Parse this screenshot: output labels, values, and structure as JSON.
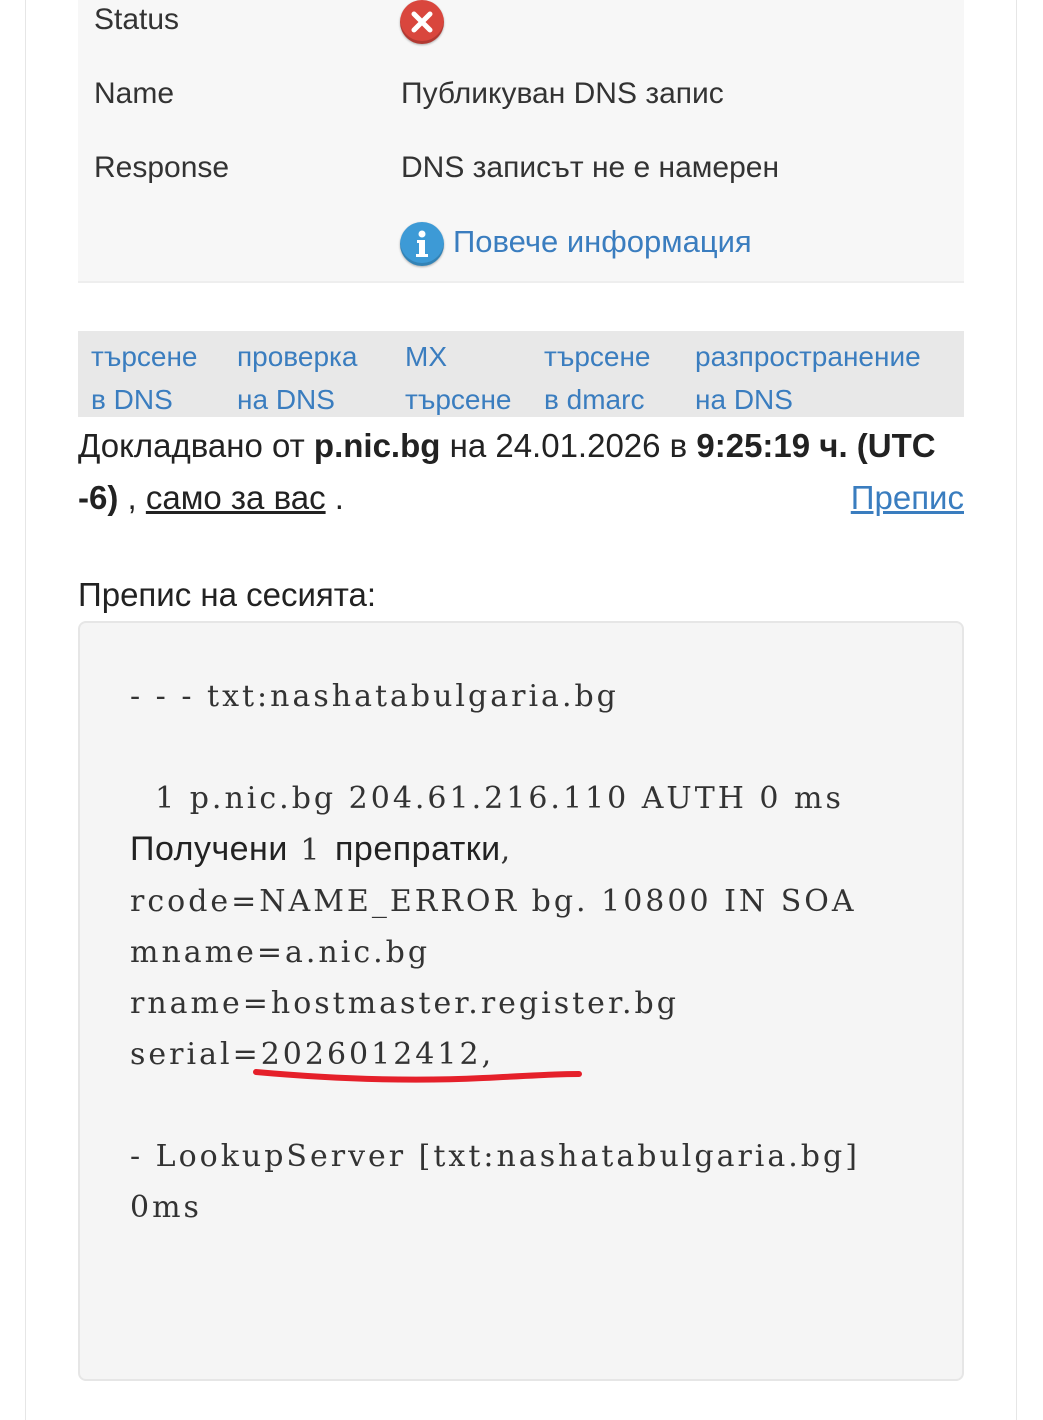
{
  "result": {
    "status_label": "Status",
    "status_icon": "error-x-icon",
    "name_label": "Name",
    "name_value": "Публикуван DNS запис",
    "response_label": "Response",
    "response_value": "DNS записът не е намерен",
    "info_icon": "info-icon",
    "more_info": "Повече информация"
  },
  "tools": [
    {
      "line1": "търсене",
      "line2": "в DNS"
    },
    {
      "line1": "проверка",
      "line2": "на DNS"
    },
    {
      "line1": "MX",
      "line2": "търсене"
    },
    {
      "line1": "търсене",
      "line2": "в dmarc"
    },
    {
      "line1": "разпространение",
      "line2": "на DNS"
    }
  ],
  "report": {
    "prefix": "Докладвано от ",
    "server": "p.nic.bg",
    "on": " на 24.01.2026 в ",
    "time": "9:25:19 ч. (UTC -6)",
    "comma": " , ",
    "only_you": "само за вас",
    "dot": " .",
    "transcript_link": "Препис"
  },
  "session": {
    "title": "Препис на сесията:",
    "line_header": "- - - txt:nashatabulgaria.bg",
    "line_1a": "  1 p.nic.bg 204.61.216.110 AUTH 0 ms ",
    "line_1b": "Получени",
    "line_1c": " 1 ",
    "line_1d": "препратки",
    "line_1e": ", rcode=NAME_ERROR bg. 10800 IN SOA mname=a.nic.bg rname=hostmaster.register.bg serial=2026012412,",
    "line_lookup": "- LookupServer [txt:nashatabulgaria.bg] 0ms"
  },
  "colors": {
    "link": "#3a7dbf",
    "error": "#d9463d",
    "info": "#3d9ad6",
    "annotation": "#e5202a"
  }
}
